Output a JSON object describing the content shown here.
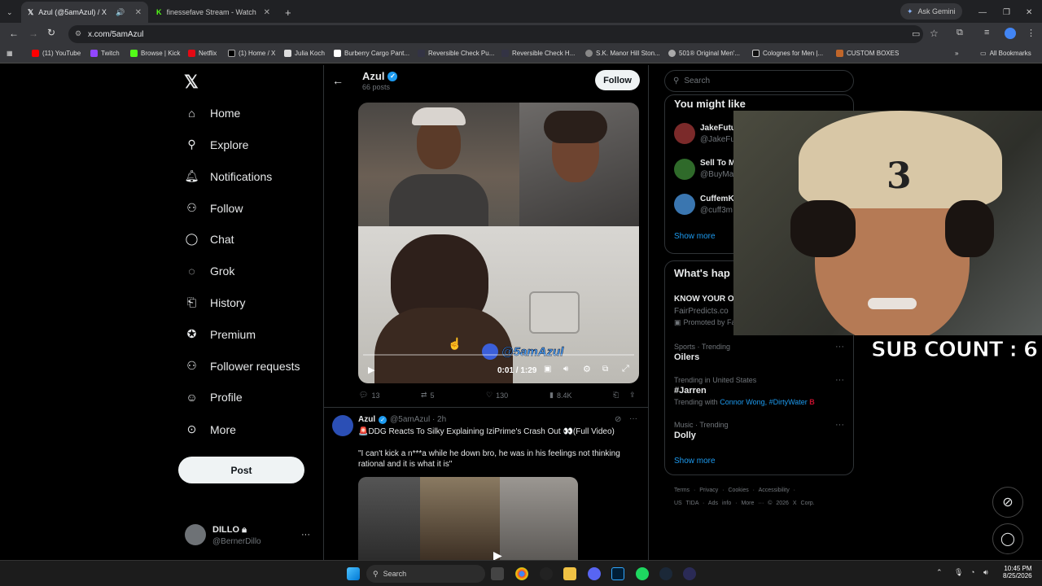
{
  "browser": {
    "tabs": [
      {
        "title": "Azul (@5amAzul) / X"
      },
      {
        "title": "finessefave Stream - Watch Live"
      }
    ],
    "new_tab": "+",
    "ask_gemini": "Ask Gemini",
    "url": "x.com/5amAzul",
    "bookmarks": [
      "(11) YouTube",
      "Twitch",
      "Browse | Kick",
      "Netflix",
      "(1) Home / X",
      "Julia Koch",
      "Burberry Cargo Pant...",
      "Reversible Check Pu...",
      "Reversible Check H...",
      "S.K. Manor Hill Ston...",
      "501® Original Men'...",
      "Colognes for Men |...",
      "CUSTOM BOXES"
    ],
    "all_bookmarks": "All Bookmarks"
  },
  "sidebar": {
    "items": [
      {
        "label": "Home",
        "icon": "home-icon"
      },
      {
        "label": "Explore",
        "icon": "search-icon"
      },
      {
        "label": "Notifications",
        "icon": "bell-icon"
      },
      {
        "label": "Follow",
        "icon": "add-person-icon"
      },
      {
        "label": "Chat",
        "icon": "chat-icon"
      },
      {
        "label": "Grok",
        "icon": "grok-icon"
      },
      {
        "label": "History",
        "icon": "bookmark-icon"
      },
      {
        "label": "Premium",
        "icon": "verified-icon"
      },
      {
        "label": "Follower requests",
        "icon": "follower-requests-icon"
      },
      {
        "label": "Profile",
        "icon": "person-icon"
      },
      {
        "label": "More",
        "icon": "more-circle-icon"
      }
    ],
    "post_label": "Post",
    "account_name": "DILLO",
    "account_handle": "@BernerDillo",
    "account_more": "···"
  },
  "header": {
    "name": "Azul",
    "posts": "66 posts",
    "follow": "Follow"
  },
  "video": {
    "time": "0:01 / 1:29",
    "watermark": "@5amAzul"
  },
  "post1_actions": {
    "replies": "13",
    "reposts": "5",
    "likes": "130",
    "views": "8.4K"
  },
  "post2": {
    "name": "Azul",
    "handle": "@5amAzul · 2h",
    "title": "🚨DDG Reacts To Silky Explaining IziPrime's Crash Out 👀(Full Video)",
    "quote": "\"I can't kick a n***a while he down bro, he was in his feelings not thinking rational and it is what it is\""
  },
  "right": {
    "search_placeholder": "Search",
    "you_might_like": "You might like",
    "suggestions": [
      {
        "name": "JakeFutu",
        "handle": "@JakeFu"
      },
      {
        "name": "Sell To M",
        "handle": "@BuyMa"
      },
      {
        "name": "CuffemK",
        "handle": "@cuff3m"
      }
    ],
    "show_more": "Show more",
    "whats_happening": "What's hap",
    "promo_title": "KNOW YOUR O",
    "promo_site": "FairPredicts.co",
    "promo_note": "Promoted by Fa",
    "trends": [
      {
        "label": "Sports · Trending",
        "name": "Oilers"
      },
      {
        "label": "Trending in United States",
        "name": "#Jarren",
        "extra_prefix": "Trending with",
        "extra": "Connor Wong, #DirtyWater"
      },
      {
        "label": "Music · Trending",
        "name": "Dolly"
      }
    ],
    "show_more_2": "Show more",
    "footer_line1": "Terms · Privacy · Cookies · Accessibility ·",
    "footer_line2": "US TIDA · Ads info · More ··· © 2026 X Corp."
  },
  "overlay": {
    "sub_count": "SUB COUNT : 6"
  },
  "taskbar": {
    "search": "Search",
    "time": "10:45 PM",
    "date": "8/25/2026"
  },
  "colors": {
    "accent": "#1d9bf0",
    "bg": "#000000",
    "text": "#e7e9ea",
    "muted": "#71767b"
  }
}
